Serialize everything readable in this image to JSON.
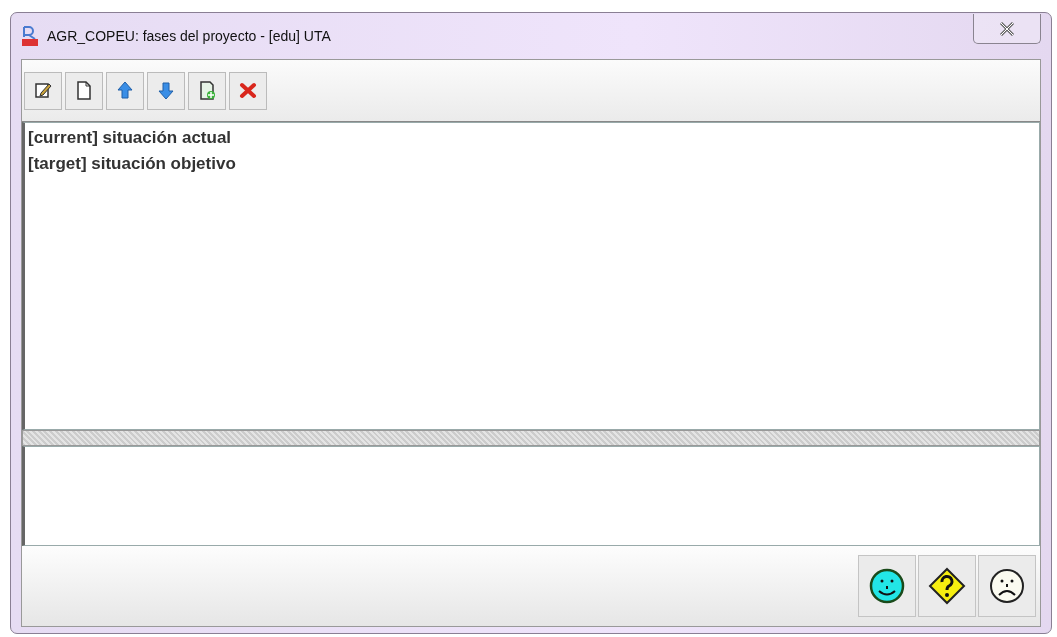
{
  "window": {
    "title": "AGR_COPEU: fases del proyecto - [edu] UTA"
  },
  "toolbar": [
    {
      "kind": "edit"
    },
    {
      "kind": "new"
    },
    {
      "kind": "up"
    },
    {
      "kind": "down"
    },
    {
      "kind": "import"
    },
    {
      "kind": "delete"
    }
  ],
  "list": {
    "items": [
      {
        "text": "[current] situación actual",
        "selected": false
      },
      {
        "text": "[target] situación objetivo",
        "selected": false
      }
    ]
  },
  "feedback_buttons": [
    {
      "kind": "happy"
    },
    {
      "kind": "help"
    },
    {
      "kind": "sad"
    }
  ]
}
